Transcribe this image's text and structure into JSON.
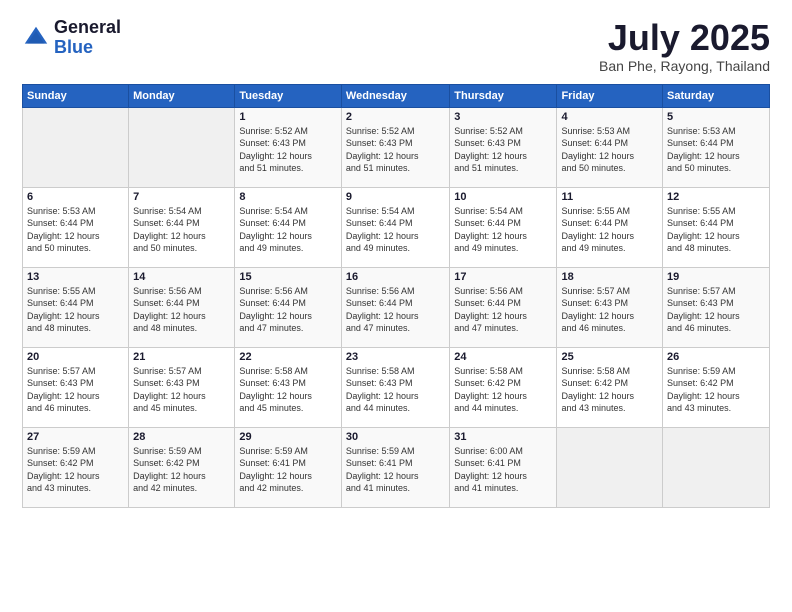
{
  "header": {
    "logo_line1": "General",
    "logo_line2": "Blue",
    "month_title": "July 2025",
    "location": "Ban Phe, Rayong, Thailand"
  },
  "weekdays": [
    "Sunday",
    "Monday",
    "Tuesday",
    "Wednesday",
    "Thursday",
    "Friday",
    "Saturday"
  ],
  "weeks": [
    [
      {
        "day": "",
        "info": ""
      },
      {
        "day": "",
        "info": ""
      },
      {
        "day": "1",
        "info": "Sunrise: 5:52 AM\nSunset: 6:43 PM\nDaylight: 12 hours\nand 51 minutes."
      },
      {
        "day": "2",
        "info": "Sunrise: 5:52 AM\nSunset: 6:43 PM\nDaylight: 12 hours\nand 51 minutes."
      },
      {
        "day": "3",
        "info": "Sunrise: 5:52 AM\nSunset: 6:43 PM\nDaylight: 12 hours\nand 51 minutes."
      },
      {
        "day": "4",
        "info": "Sunrise: 5:53 AM\nSunset: 6:44 PM\nDaylight: 12 hours\nand 50 minutes."
      },
      {
        "day": "5",
        "info": "Sunrise: 5:53 AM\nSunset: 6:44 PM\nDaylight: 12 hours\nand 50 minutes."
      }
    ],
    [
      {
        "day": "6",
        "info": "Sunrise: 5:53 AM\nSunset: 6:44 PM\nDaylight: 12 hours\nand 50 minutes."
      },
      {
        "day": "7",
        "info": "Sunrise: 5:54 AM\nSunset: 6:44 PM\nDaylight: 12 hours\nand 50 minutes."
      },
      {
        "day": "8",
        "info": "Sunrise: 5:54 AM\nSunset: 6:44 PM\nDaylight: 12 hours\nand 49 minutes."
      },
      {
        "day": "9",
        "info": "Sunrise: 5:54 AM\nSunset: 6:44 PM\nDaylight: 12 hours\nand 49 minutes."
      },
      {
        "day": "10",
        "info": "Sunrise: 5:54 AM\nSunset: 6:44 PM\nDaylight: 12 hours\nand 49 minutes."
      },
      {
        "day": "11",
        "info": "Sunrise: 5:55 AM\nSunset: 6:44 PM\nDaylight: 12 hours\nand 49 minutes."
      },
      {
        "day": "12",
        "info": "Sunrise: 5:55 AM\nSunset: 6:44 PM\nDaylight: 12 hours\nand 48 minutes."
      }
    ],
    [
      {
        "day": "13",
        "info": "Sunrise: 5:55 AM\nSunset: 6:44 PM\nDaylight: 12 hours\nand 48 minutes."
      },
      {
        "day": "14",
        "info": "Sunrise: 5:56 AM\nSunset: 6:44 PM\nDaylight: 12 hours\nand 48 minutes."
      },
      {
        "day": "15",
        "info": "Sunrise: 5:56 AM\nSunset: 6:44 PM\nDaylight: 12 hours\nand 47 minutes."
      },
      {
        "day": "16",
        "info": "Sunrise: 5:56 AM\nSunset: 6:44 PM\nDaylight: 12 hours\nand 47 minutes."
      },
      {
        "day": "17",
        "info": "Sunrise: 5:56 AM\nSunset: 6:44 PM\nDaylight: 12 hours\nand 47 minutes."
      },
      {
        "day": "18",
        "info": "Sunrise: 5:57 AM\nSunset: 6:43 PM\nDaylight: 12 hours\nand 46 minutes."
      },
      {
        "day": "19",
        "info": "Sunrise: 5:57 AM\nSunset: 6:43 PM\nDaylight: 12 hours\nand 46 minutes."
      }
    ],
    [
      {
        "day": "20",
        "info": "Sunrise: 5:57 AM\nSunset: 6:43 PM\nDaylight: 12 hours\nand 46 minutes."
      },
      {
        "day": "21",
        "info": "Sunrise: 5:57 AM\nSunset: 6:43 PM\nDaylight: 12 hours\nand 45 minutes."
      },
      {
        "day": "22",
        "info": "Sunrise: 5:58 AM\nSunset: 6:43 PM\nDaylight: 12 hours\nand 45 minutes."
      },
      {
        "day": "23",
        "info": "Sunrise: 5:58 AM\nSunset: 6:43 PM\nDaylight: 12 hours\nand 44 minutes."
      },
      {
        "day": "24",
        "info": "Sunrise: 5:58 AM\nSunset: 6:42 PM\nDaylight: 12 hours\nand 44 minutes."
      },
      {
        "day": "25",
        "info": "Sunrise: 5:58 AM\nSunset: 6:42 PM\nDaylight: 12 hours\nand 43 minutes."
      },
      {
        "day": "26",
        "info": "Sunrise: 5:59 AM\nSunset: 6:42 PM\nDaylight: 12 hours\nand 43 minutes."
      }
    ],
    [
      {
        "day": "27",
        "info": "Sunrise: 5:59 AM\nSunset: 6:42 PM\nDaylight: 12 hours\nand 43 minutes."
      },
      {
        "day": "28",
        "info": "Sunrise: 5:59 AM\nSunset: 6:42 PM\nDaylight: 12 hours\nand 42 minutes."
      },
      {
        "day": "29",
        "info": "Sunrise: 5:59 AM\nSunset: 6:41 PM\nDaylight: 12 hours\nand 42 minutes."
      },
      {
        "day": "30",
        "info": "Sunrise: 5:59 AM\nSunset: 6:41 PM\nDaylight: 12 hours\nand 41 minutes."
      },
      {
        "day": "31",
        "info": "Sunrise: 6:00 AM\nSunset: 6:41 PM\nDaylight: 12 hours\nand 41 minutes."
      },
      {
        "day": "",
        "info": ""
      },
      {
        "day": "",
        "info": ""
      }
    ]
  ]
}
